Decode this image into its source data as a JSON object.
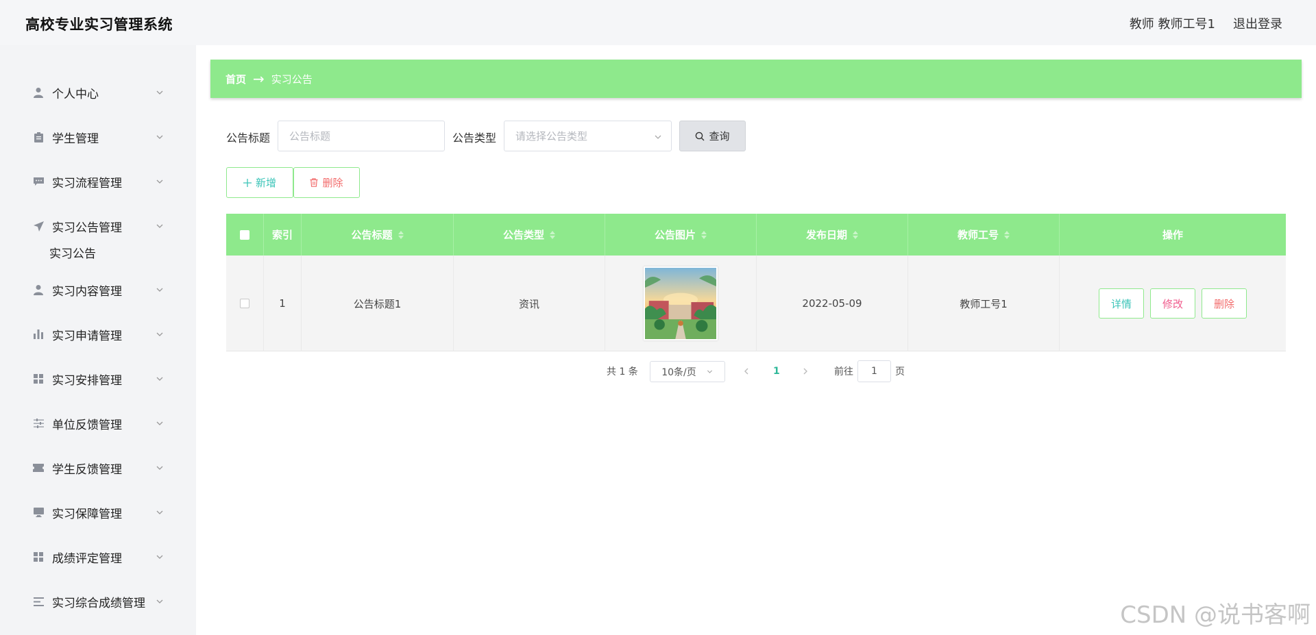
{
  "header": {
    "app_title": "高校专业实习管理系统",
    "user_role": "教师",
    "user_name": "教师工号1",
    "logout": "退出登录"
  },
  "sidebar": {
    "items": [
      {
        "label": "个人中心",
        "icon": "user-icon"
      },
      {
        "label": "学生管理",
        "icon": "clipboard-icon"
      },
      {
        "label": "实习流程管理",
        "icon": "chat-icon"
      },
      {
        "label": "实习公告管理",
        "icon": "send-icon",
        "expanded": true,
        "children": [
          "实习公告"
        ]
      },
      {
        "label": "实习内容管理",
        "icon": "user-icon"
      },
      {
        "label": "实习申请管理",
        "icon": "bar-chart-icon"
      },
      {
        "label": "实习安排管理",
        "icon": "grid-icon"
      },
      {
        "label": "单位反馈管理",
        "icon": "sliders-icon"
      },
      {
        "label": "学生反馈管理",
        "icon": "ticket-icon"
      },
      {
        "label": "实习保障管理",
        "icon": "monitor-icon"
      },
      {
        "label": "成绩评定管理",
        "icon": "grid-icon"
      },
      {
        "label": "实习综合成绩管理",
        "icon": "list-icon"
      }
    ]
  },
  "breadcrumb": {
    "home": "首页",
    "separator": "→",
    "current": "实习公告"
  },
  "search": {
    "title_label": "公告标题",
    "title_placeholder": "公告标题",
    "type_label": "公告类型",
    "type_placeholder": "请选择公告类型",
    "query_button": "查询"
  },
  "actions": {
    "add": "新增",
    "delete": "删除"
  },
  "table": {
    "columns": [
      "索引",
      "公告标题",
      "公告类型",
      "公告图片",
      "发布日期",
      "教师工号",
      "操作"
    ],
    "rows": [
      {
        "index": "1",
        "title": "公告标题1",
        "type": "资讯",
        "date": "2022-05-09",
        "teacher_id": "教师工号1",
        "ops": [
          "详情",
          "修改",
          "删除"
        ]
      }
    ]
  },
  "pagination": {
    "total": "共 1 条",
    "page_size": "10条/页",
    "current_page": "1",
    "goto_label": "前往",
    "goto_value": "1",
    "page_unit": "页"
  },
  "colors": {
    "accent_green": "#8ee98c",
    "teal": "#3bc4b8",
    "pink": "#f05b8c",
    "delete_red": "#f26b6b",
    "page_active": "#2fb899"
  },
  "watermark": "CSDN @说书客啊"
}
